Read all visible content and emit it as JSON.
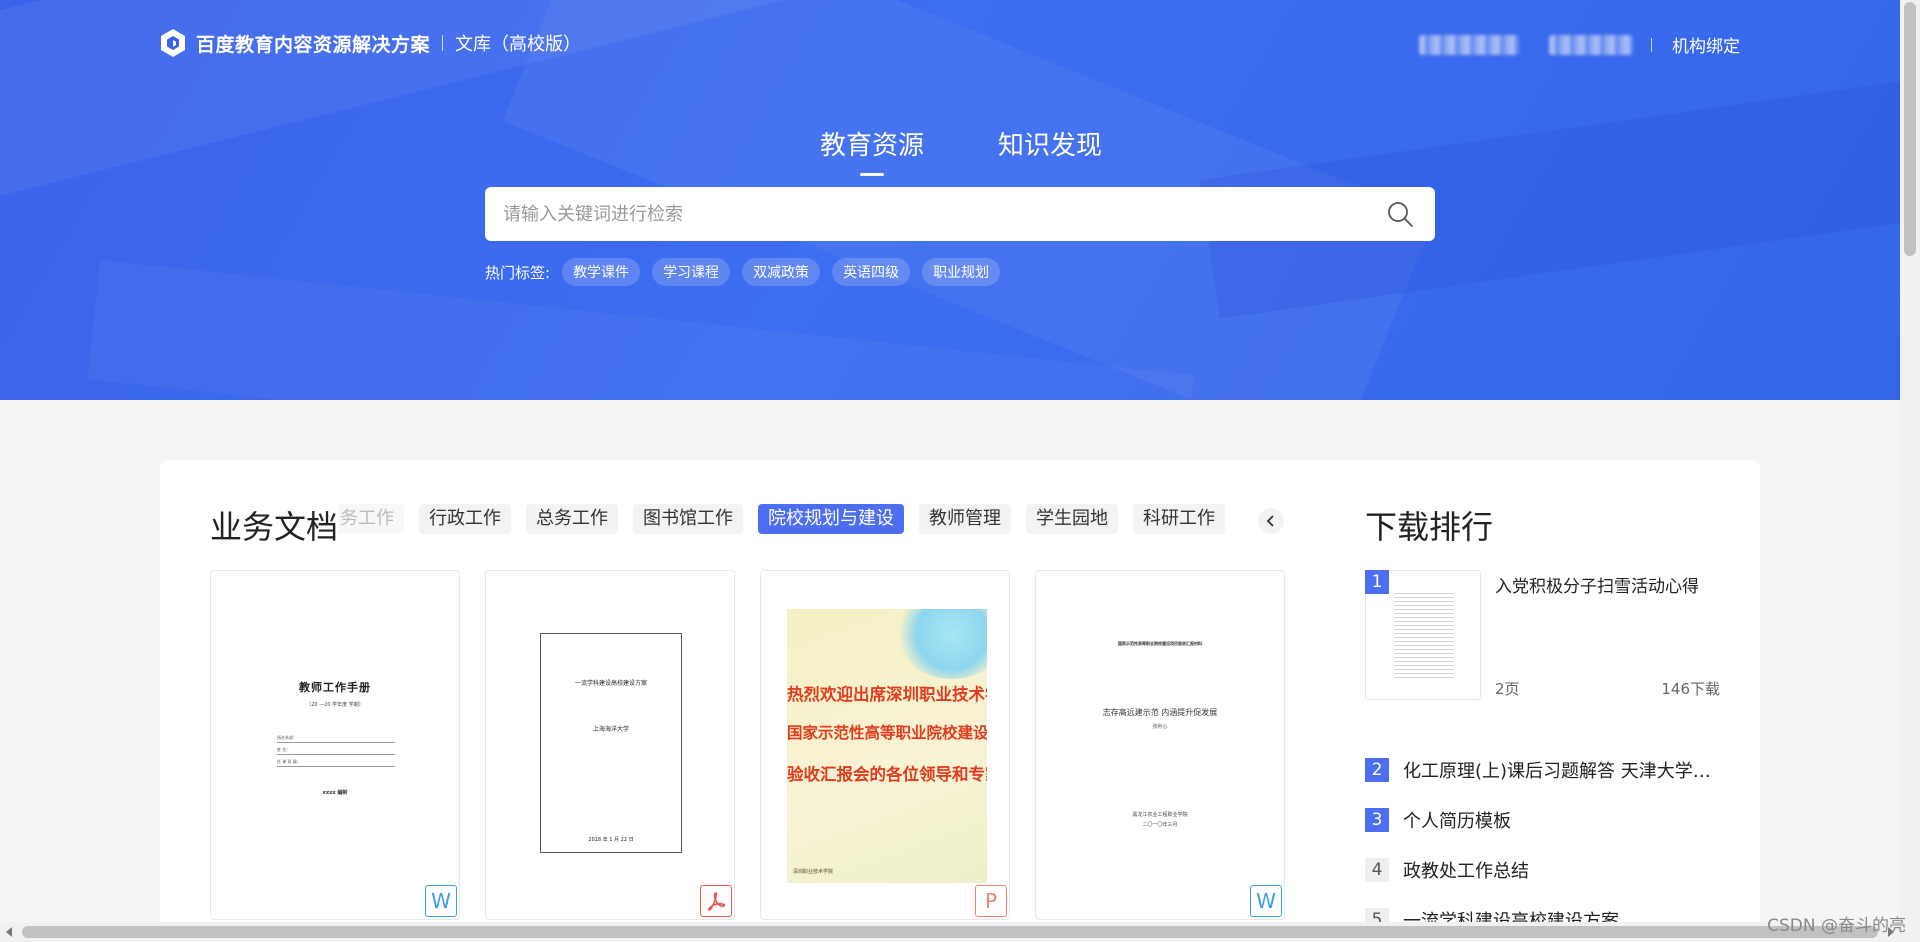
{
  "header": {
    "brand_title": "百度教育内容资源解决方案",
    "brand_sub": "文库（高校版）",
    "bind_link": "机构绑定"
  },
  "hero": {
    "tabs": [
      {
        "label": "教育资源",
        "active": true
      },
      {
        "label": "知识发现",
        "active": false
      }
    ],
    "search": {
      "placeholder": "请输入关键词进行检索",
      "value": ""
    },
    "hot_label": "热门标签:",
    "hot_tags": [
      "教学课件",
      "学习课程",
      "双减政策",
      "英语四级",
      "职业规划"
    ]
  },
  "business_docs": {
    "title": "业务文档",
    "categories": [
      {
        "label": "务工作",
        "state": "faded"
      },
      {
        "label": "行政工作",
        "state": "normal"
      },
      {
        "label": "总务工作",
        "state": "normal"
      },
      {
        "label": "图书馆工作",
        "state": "normal"
      },
      {
        "label": "院校规划与建设",
        "state": "active"
      },
      {
        "label": "教师管理",
        "state": "normal"
      },
      {
        "label": "学生园地",
        "state": "normal"
      },
      {
        "label": "科研工作",
        "state": "normal"
      }
    ],
    "docs": [
      {
        "type": "W",
        "title": "教师工作手册",
        "subtitle": "（20 —20 学年度 学期）",
        "fields": [
          "所在系部：",
          "姓  名：",
          "任 课 班 级："
        ],
        "footer": "xxxx 编制"
      },
      {
        "type": "PDF",
        "title": "一流学科建设高校建设方案",
        "subtitle": "上海海洋大学",
        "footer": "2018 年 1 月 22 日"
      },
      {
        "type": "P",
        "slide_lines": [
          "热烈欢迎出席深圳职业技术学院",
          "国家示范性高等职业院校建设项目",
          "验收汇报会的各位领导和专家！"
        ],
        "footer": "深圳职业技术学院"
      },
      {
        "type": "W",
        "header_line": "国家示范性高等职业院校建设项目验收汇报材料",
        "title": "志存高远建示范  内涵提升促发展",
        "author": "张利心",
        "footer_lines": [
          "黑龙江农业工程职业学院",
          "二〇一〇年三月"
        ]
      }
    ]
  },
  "ranking": {
    "title": "下载排行",
    "items": [
      {
        "rank": "1",
        "title": "入党积极分子扫雪活动心得",
        "pages": "2页",
        "downloads": "146下载"
      },
      {
        "rank": "2",
        "title": "化工原理(上)课后习题解答 天津大学化工学院"
      },
      {
        "rank": "3",
        "title": "个人简历模板"
      },
      {
        "rank": "4",
        "title": "政教处工作总结"
      },
      {
        "rank": "5",
        "title": "一流学科建设高校建设方案"
      }
    ]
  },
  "watermark": "CSDN @奋斗的亮",
  "colors": {
    "accent": "#4e6ef2",
    "word": "#3a9ee8",
    "pdf": "#e5574a",
    "ppt": "#f0856b",
    "hero": "#3a63ea"
  },
  "icons": {
    "brand": "hexagon-logo-icon",
    "search": "search-icon",
    "prev": "chevron-left-icon"
  }
}
